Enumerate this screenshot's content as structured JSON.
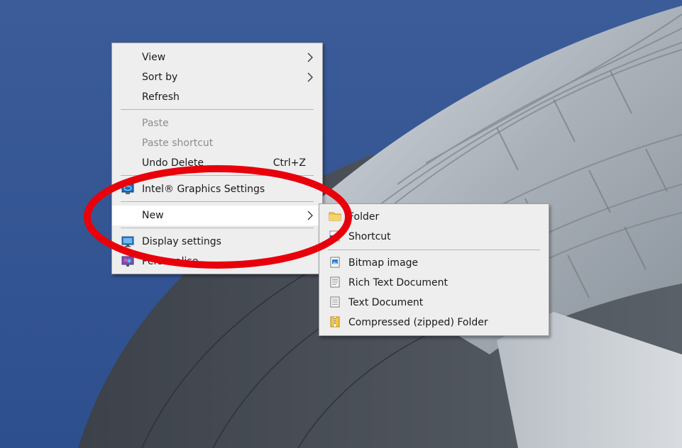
{
  "context_menu": {
    "items": [
      {
        "label": "View",
        "submenu": true
      },
      {
        "label": "Sort by",
        "submenu": true
      },
      {
        "label": "Refresh"
      },
      {
        "label": "Paste",
        "disabled": true
      },
      {
        "label": "Paste shortcut",
        "disabled": true
      },
      {
        "label": "Undo Delete",
        "shortcut": "Ctrl+Z"
      },
      {
        "label": "Intel® Graphics Settings",
        "icon": "intel-graphics-icon"
      },
      {
        "label": "New",
        "submenu": true,
        "highlighted": true
      },
      {
        "label": "Display settings",
        "icon": "display-icon"
      },
      {
        "label": "Personalise",
        "icon": "personalise-icon"
      }
    ]
  },
  "new_submenu": {
    "items": [
      {
        "label": "Folder",
        "icon": "folder-icon"
      },
      {
        "label": "Shortcut",
        "icon": "shortcut-icon"
      },
      {
        "label": "Bitmap image",
        "icon": "bitmap-image-icon"
      },
      {
        "label": "Rich Text Document",
        "icon": "rich-text-document-icon"
      },
      {
        "label": "Text Document",
        "icon": "text-document-icon"
      },
      {
        "label": "Compressed (zipped) Folder",
        "icon": "zip-folder-icon"
      }
    ]
  },
  "colors": {
    "sky": "#3d5f9c",
    "menu_bg": "#eeeeee",
    "highlight": "#ffffff",
    "annotation": "#e8000b"
  }
}
